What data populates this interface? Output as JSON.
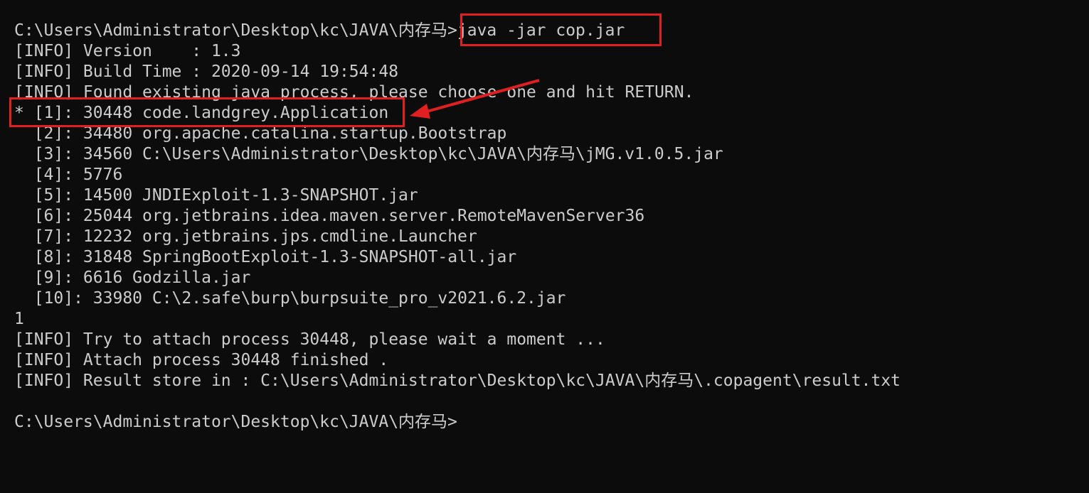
{
  "terminal": {
    "lines": [
      "",
      "C:\\Users\\Administrator\\Desktop\\kc\\JAVA\\内存马>java -jar cop.jar",
      "[INFO] Version    : 1.3",
      "[INFO] Build Time : 2020-09-14 19:54:48",
      "[INFO] Found existing java process, please choose one and hit RETURN.",
      "* [1]: 30448 code.landgrey.Application",
      "  [2]: 34480 org.apache.catalina.startup.Bootstrap",
      "  [3]: 34560 C:\\Users\\Administrator\\Desktop\\kc\\JAVA\\内存马\\jMG.v1.0.5.jar",
      "  [4]: 5776",
      "  [5]: 14500 JNDIExploit-1.3-SNAPSHOT.jar",
      "  [6]: 25044 org.jetbrains.idea.maven.server.RemoteMavenServer36",
      "  [7]: 12232 org.jetbrains.jps.cmdline.Launcher",
      "  [8]: 31848 SpringBootExploit-1.3-SNAPSHOT-all.jar",
      "  [9]: 6616 Godzilla.jar",
      "  [10]: 33980 C:\\2.safe\\burp\\burpsuite_pro_v2021.6.2.jar",
      "1",
      "[INFO] Try to attach process 30448, please wait a moment ...",
      "[INFO] Attach process 30448 finished .",
      "[INFO] Result store in : C:\\Users\\Administrator\\Desktop\\kc\\JAVA\\内存马\\.copagent\\result.txt",
      "",
      "C:\\Users\\Administrator\\Desktop\\kc\\JAVA\\内存马>"
    ]
  },
  "colors": {
    "background": "#0c0c0c",
    "text": "#cccccc",
    "annotation": "#e02020"
  }
}
